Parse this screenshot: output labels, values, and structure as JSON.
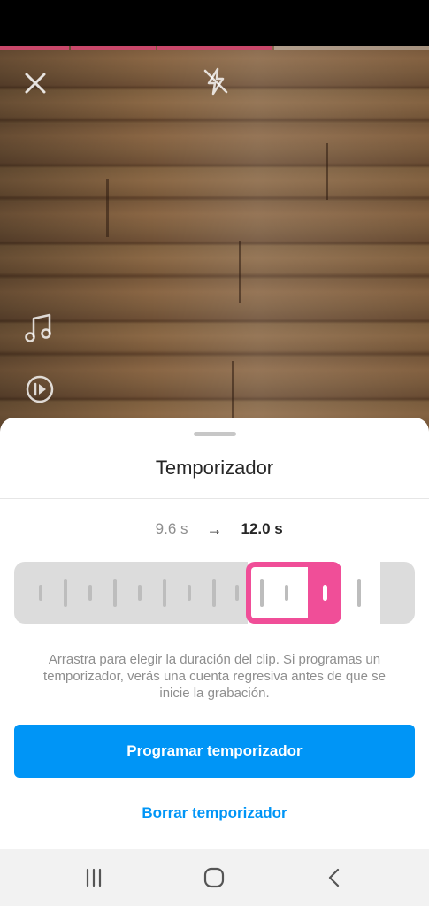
{
  "camera": {
    "icons": {
      "close": "close-icon",
      "flash": "flash-off-icon",
      "music": "music-note-icon",
      "speed": "playback-speed-icon"
    },
    "progress_color": "#c9486a"
  },
  "sheet": {
    "title": "Temporizador",
    "duration_start": "9.6 s",
    "arrow": "→",
    "duration_end": "12.0 s",
    "help_text": "Arrastra para elegir la duración del clip. Si programas un temporizador, verás una cuenta regresiva antes de que se inicie la grabación.",
    "primary_button": "Programar temporizador",
    "secondary_button": "Borrar temporizador",
    "accent_color": "#0095f6",
    "handle_color": "#f04e98"
  },
  "navbar": {
    "icons": [
      "recent-apps-icon",
      "home-icon",
      "back-icon"
    ]
  }
}
